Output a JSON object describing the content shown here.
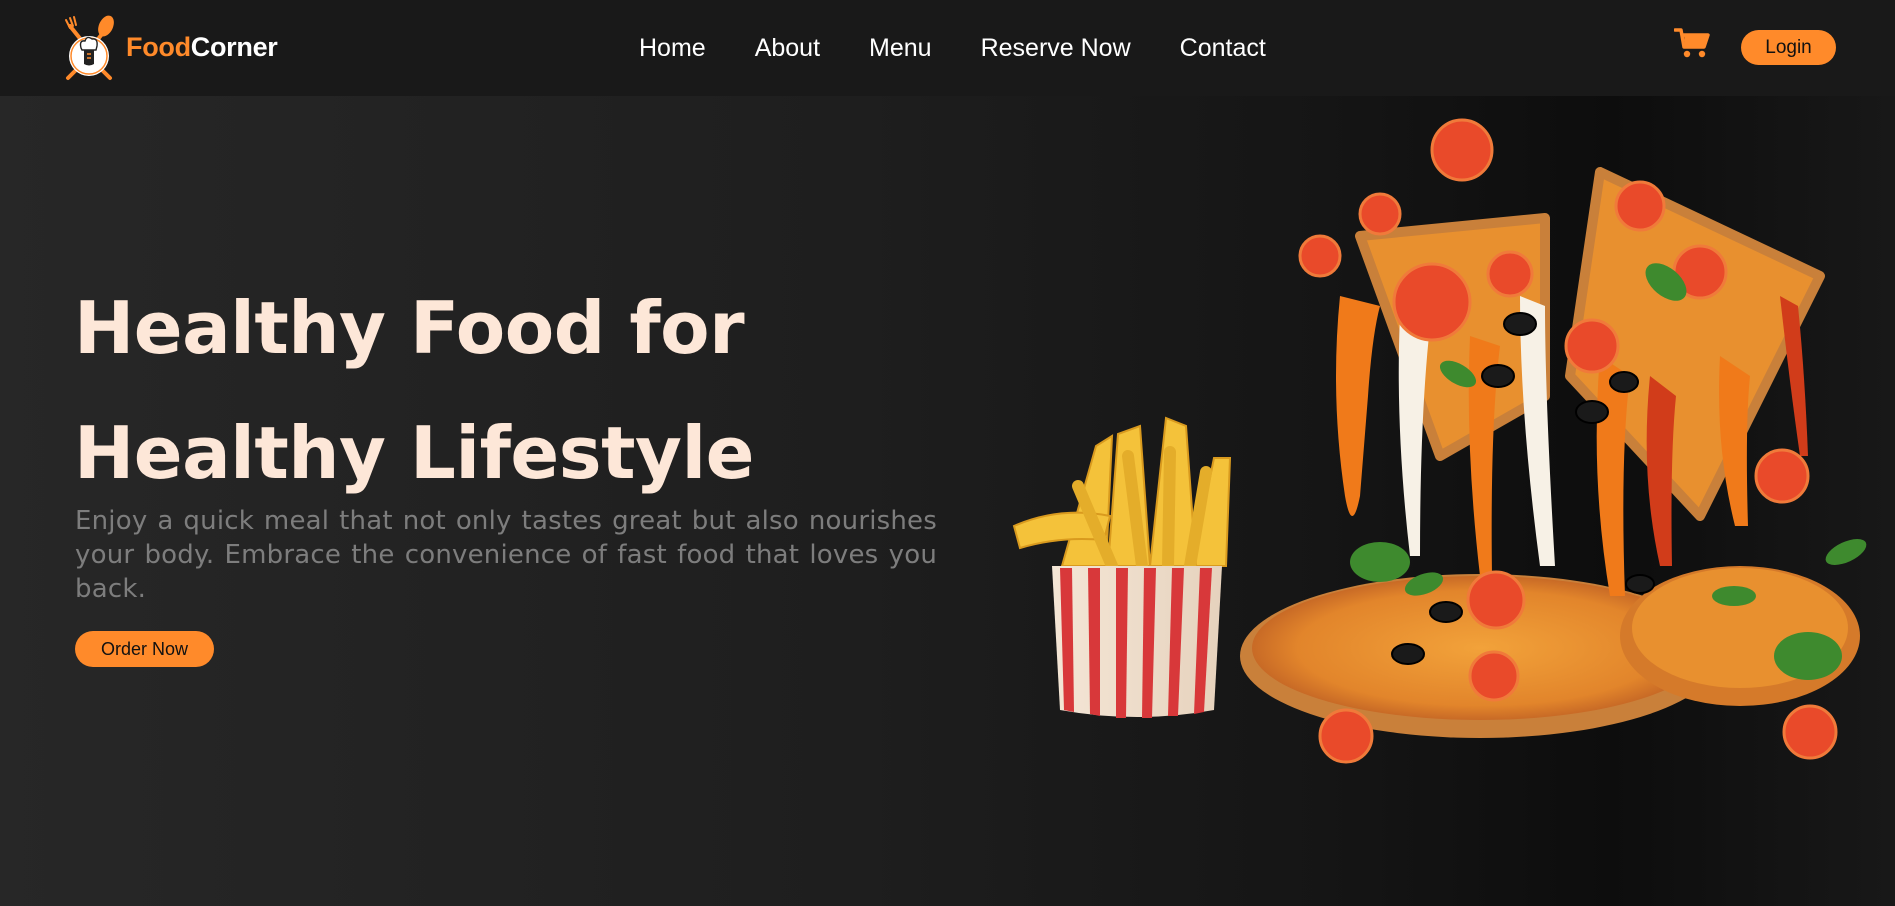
{
  "brand": {
    "name_part1": "Food",
    "name_part2": "Corner",
    "logo_icon": "chef-logo-icon"
  },
  "nav": {
    "links": [
      {
        "label": "Home"
      },
      {
        "label": "About"
      },
      {
        "label": "Menu"
      },
      {
        "label": "Reserve Now"
      },
      {
        "label": "Contact"
      }
    ],
    "cart_icon": "cart-icon",
    "login_label": "Login"
  },
  "hero": {
    "title_line1": "Healthy Food for",
    "title_line2": "Healthy Lifestyle",
    "description": "Enjoy a quick meal that not only tastes great but also nourishes your body. Embrace the convenience of fast food that loves you back.",
    "order_label": "Order Now"
  },
  "colors": {
    "accent": "#ff8a2a",
    "navbar_bg": "#191919",
    "hero_bg": "#232323",
    "title": "#fde7d8",
    "description": "#7d7d7d"
  }
}
